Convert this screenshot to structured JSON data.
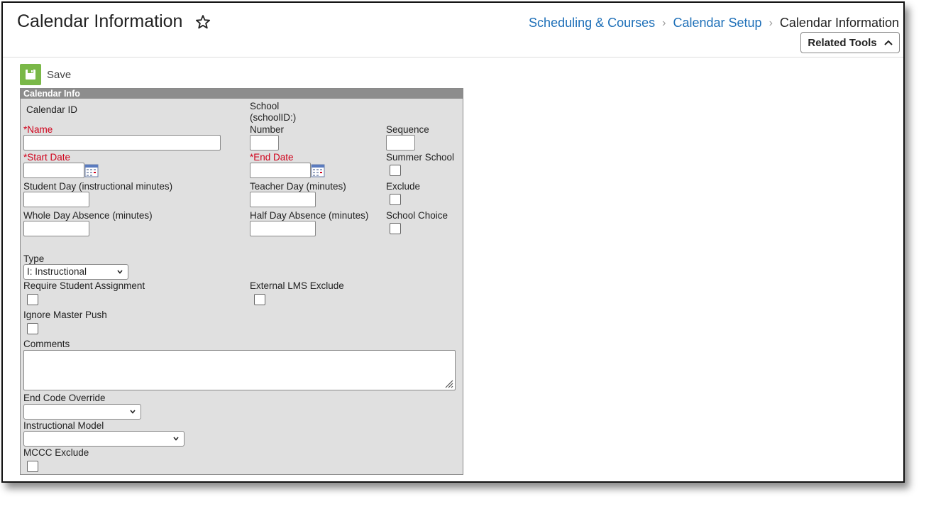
{
  "header": {
    "title": "Calendar Information",
    "breadcrumbs": [
      "Scheduling & Courses",
      "Calendar Setup",
      "Calendar Information"
    ],
    "related_tools": "Related Tools"
  },
  "toolbar": {
    "save_label": "Save"
  },
  "form": {
    "section_title": "Calendar Info",
    "calendar_id_label": "Calendar ID",
    "school_label": "School",
    "school_id_label": "(schoolID:)",
    "name_label": "*Name",
    "number_label": "Number",
    "sequence_label": "Sequence",
    "start_date_label": "*Start Date",
    "end_date_label": "*End Date",
    "summer_school_label": "Summer School",
    "student_day_label": "Student Day (instructional minutes)",
    "teacher_day_label": "Teacher Day (minutes)",
    "exclude_label": "Exclude",
    "whole_day_label": "Whole Day Absence (minutes)",
    "half_day_label": "Half Day Absence (minutes)",
    "school_choice_label": "School Choice",
    "type_label": "Type",
    "type_value": "I: Instructional",
    "require_student_label": "Require Student Assignment",
    "external_lms_label": "External LMS Exclude",
    "ignore_master_label": "Ignore Master Push",
    "comments_label": "Comments",
    "end_code_label": "End Code Override",
    "instructional_model_label": "Instructional Model",
    "mccc_label": "MCCC Exclude"
  },
  "colors": {
    "link": "#1d6fb8",
    "required": "#d0021b",
    "save_icon": "#7ab848",
    "panel_header": "#8d8d8d"
  }
}
